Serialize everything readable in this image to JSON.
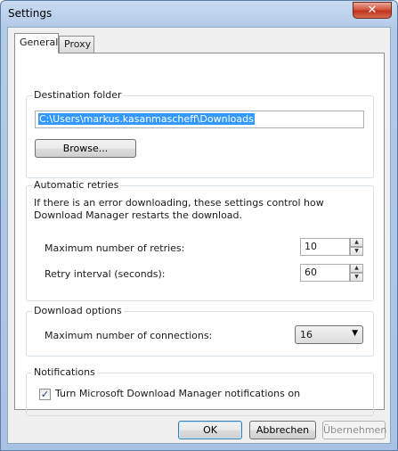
{
  "window": {
    "title": "Settings",
    "close_glyph": "✕"
  },
  "tabs": [
    {
      "label": "General",
      "active": true
    },
    {
      "label": "Proxy",
      "active": false
    }
  ],
  "destination": {
    "group_label": "Destination folder",
    "path_value": "C:\\Users\\markus.kasanmascheff\\Downloads",
    "browse_label": "Browse..."
  },
  "retries": {
    "group_label": "Automatic retries",
    "description": "If there is an error downloading, these settings control how Download Manager restarts the download.",
    "max_retries_label": "Maximum number of retries:",
    "max_retries_value": "10",
    "interval_label": "Retry interval (seconds):",
    "interval_value": "60"
  },
  "download_options": {
    "group_label": "Download options",
    "connections_label": "Maximum number of connections:",
    "connections_value": "16"
  },
  "notifications": {
    "group_label": "Notifications",
    "checkbox_label": "Turn Microsoft Download Manager notifications on",
    "checked": true
  },
  "buttons": {
    "ok": "OK",
    "cancel": "Abbrechen",
    "apply": "Übernehmen"
  }
}
